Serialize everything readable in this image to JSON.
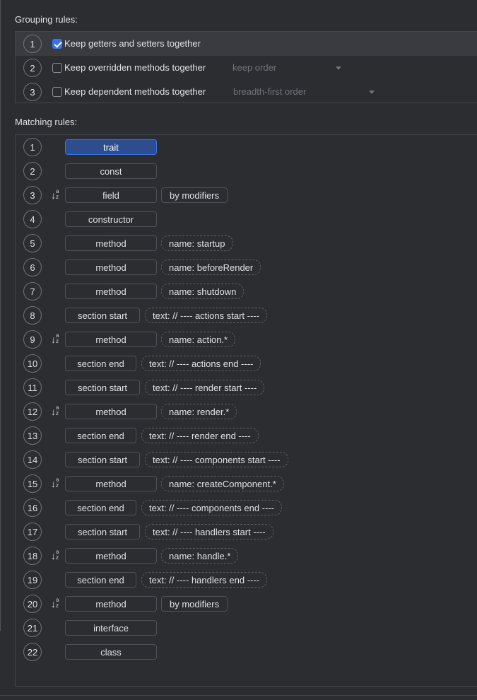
{
  "grouping": {
    "title": "Grouping rules:",
    "rows": [
      {
        "num": "1",
        "label": "Keep getters and setters together",
        "checked": true,
        "dropdown": ""
      },
      {
        "num": "2",
        "label": "Keep overridden methods together",
        "checked": false,
        "dropdown": "keep order"
      },
      {
        "num": "3",
        "label": "Keep dependent methods together",
        "checked": false,
        "dropdown": "breadth-first order"
      }
    ]
  },
  "matching": {
    "title": "Matching rules:",
    "rows": [
      {
        "num": "1",
        "sort": false,
        "type": "trait",
        "mod": "",
        "cond": ""
      },
      {
        "num": "2",
        "sort": false,
        "type": "const",
        "mod": "",
        "cond": ""
      },
      {
        "num": "3",
        "sort": true,
        "type": "field",
        "mod": "by modifiers",
        "cond": ""
      },
      {
        "num": "4",
        "sort": false,
        "type": "constructor",
        "mod": "",
        "cond": ""
      },
      {
        "num": "5",
        "sort": false,
        "type": "method",
        "mod": "",
        "cond": "name: startup"
      },
      {
        "num": "6",
        "sort": false,
        "type": "method",
        "mod": "",
        "cond": "name: beforeRender"
      },
      {
        "num": "7",
        "sort": false,
        "type": "method",
        "mod": "",
        "cond": "name: shutdown"
      },
      {
        "num": "8",
        "sort": false,
        "type": "section start",
        "mod": "",
        "cond": "text: // ---- actions start ----"
      },
      {
        "num": "9",
        "sort": true,
        "type": "method",
        "mod": "",
        "cond": "name: action.*"
      },
      {
        "num": "10",
        "sort": false,
        "type": "section end",
        "mod": "",
        "cond": "text: // ---- actions end ----"
      },
      {
        "num": "11",
        "sort": false,
        "type": "section start",
        "mod": "",
        "cond": "text: // ---- render start ----"
      },
      {
        "num": "12",
        "sort": true,
        "type": "method",
        "mod": "",
        "cond": "name: render.*"
      },
      {
        "num": "13",
        "sort": false,
        "type": "section end",
        "mod": "",
        "cond": "text: // ---- render end ----"
      },
      {
        "num": "14",
        "sort": false,
        "type": "section start",
        "mod": "",
        "cond": "text: // ---- components start ----"
      },
      {
        "num": "15",
        "sort": true,
        "type": "method",
        "mod": "",
        "cond": "name: createComponent.*"
      },
      {
        "num": "16",
        "sort": false,
        "type": "section end",
        "mod": "",
        "cond": "text: // ---- components end ----"
      },
      {
        "num": "17",
        "sort": false,
        "type": "section start",
        "mod": "",
        "cond": "text: // ---- handlers start ----"
      },
      {
        "num": "18",
        "sort": true,
        "type": "method",
        "mod": "",
        "cond": "name: handle.*"
      },
      {
        "num": "19",
        "sort": false,
        "type": "section end",
        "mod": "",
        "cond": "text: // ---- handlers end ----"
      },
      {
        "num": "20",
        "sort": true,
        "type": "method",
        "mod": "by modifiers",
        "cond": ""
      },
      {
        "num": "21",
        "sort": false,
        "type": "interface",
        "mod": "",
        "cond": ""
      },
      {
        "num": "22",
        "sort": false,
        "type": "class",
        "mod": "",
        "cond": ""
      }
    ]
  },
  "icons": {
    "sort": "sort-alphabetically-icon",
    "checkbox": "checkbox-icon",
    "caret": "chevron-down-icon"
  },
  "colors": {
    "accent": "#3574f0",
    "selected_token_bg": "#2e4d8f",
    "background": "#2b2d30"
  }
}
